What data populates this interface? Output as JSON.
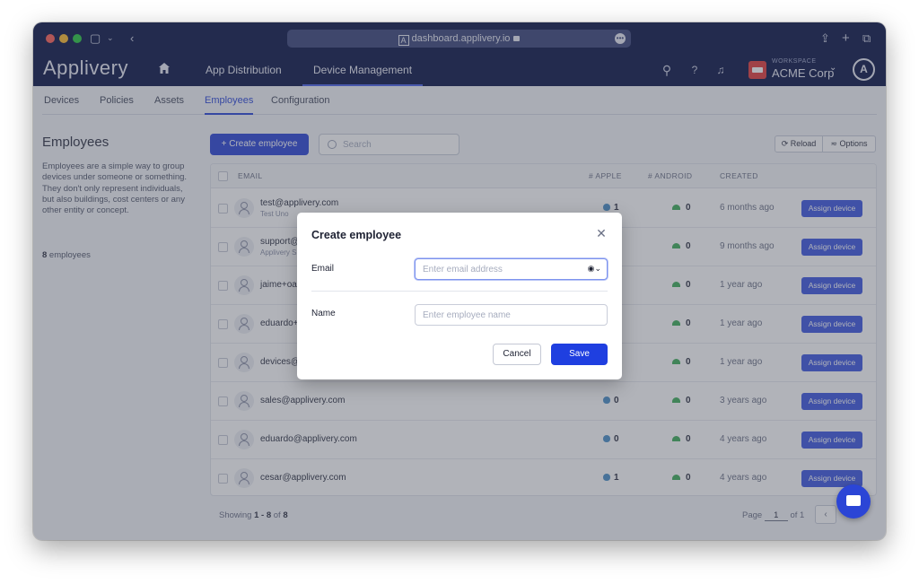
{
  "browser": {
    "url": "dashboard.applivery.io",
    "tab_icon": "A"
  },
  "app": {
    "logo": "Applivery",
    "nav": [
      {
        "label": "App Distribution"
      },
      {
        "label": "Device Management"
      }
    ],
    "workspace_label": "WORKSPACE",
    "workspace_name": "ACME Corp",
    "avatar": "A"
  },
  "subtabs": [
    {
      "label": "Devices"
    },
    {
      "label": "Policies"
    },
    {
      "label": "Assets"
    },
    {
      "label": "Employees"
    },
    {
      "label": "Configuration"
    }
  ],
  "left_panel": {
    "title": "Employees",
    "description": "Employees are a simple way to group devices under someone or something. They don't only represent individuals, but also buildings, cost centers or any other entity or concept.",
    "count_number": "8",
    "count_text": " employees"
  },
  "toolbar": {
    "create_label": "+ Create employee",
    "search_placeholder": "Search",
    "reload_label": "Reload",
    "options_label": "Options"
  },
  "table": {
    "headers": {
      "email": "EMAIL",
      "apple": "# APPLE",
      "android": "# ANDROID",
      "created": "CREATED"
    },
    "assign_label": "Assign device",
    "rows": [
      {
        "email": "test@applivery.com",
        "sub": "Test Uno",
        "apple": "1",
        "android": "0",
        "created": "6 months ago"
      },
      {
        "email": "support@",
        "sub": "Applivery S",
        "apple": "",
        "android": "0",
        "created": "9 months ago"
      },
      {
        "email": "jaime+oa",
        "sub": "",
        "apple": "",
        "android": "0",
        "created": "1 year ago"
      },
      {
        "email": "eduardo+",
        "sub": "",
        "apple": "",
        "android": "0",
        "created": "1 year ago"
      },
      {
        "email": "devices@",
        "sub": "",
        "apple": "",
        "android": "0",
        "created": "1 year ago"
      },
      {
        "email": "sales@applivery.com",
        "sub": "",
        "apple": "0",
        "android": "0",
        "created": "3 years ago"
      },
      {
        "email": "eduardo@applivery.com",
        "sub": "",
        "apple": "0",
        "android": "0",
        "created": "4 years ago"
      },
      {
        "email": "cesar@applivery.com",
        "sub": "",
        "apple": "1",
        "android": "0",
        "created": "4 years ago"
      }
    ]
  },
  "footer": {
    "showing_prefix": "Showing ",
    "showing_range": "1 - 8",
    "showing_of": " of ",
    "showing_total": "8",
    "page_label": "Page",
    "page_value": "1",
    "page_of": "of 1"
  },
  "modal": {
    "title": "Create employee",
    "email_label": "Email",
    "email_placeholder": "Enter email address",
    "name_label": "Name",
    "name_placeholder": "Enter employee name",
    "cancel_label": "Cancel",
    "save_label": "Save"
  }
}
